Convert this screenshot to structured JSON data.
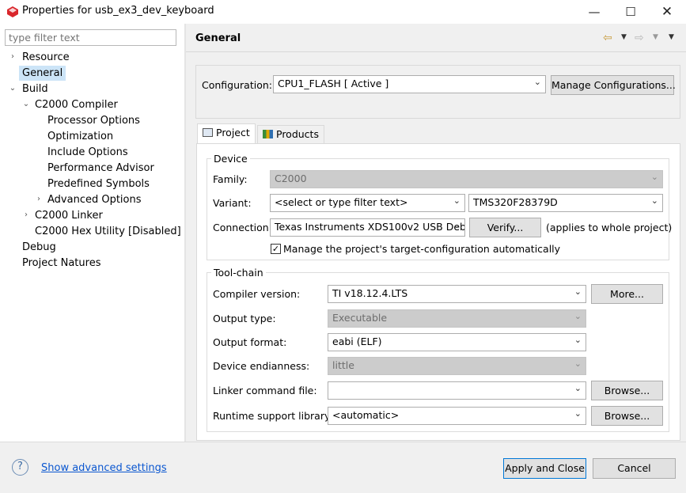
{
  "window": {
    "title": "Properties for usb_ex3_dev_keyboard"
  },
  "sidebar": {
    "filter_placeholder": "type filter text",
    "items": [
      {
        "label": "Resource"
      },
      {
        "label": "General"
      },
      {
        "label": "Build"
      },
      {
        "label": "C2000 Compiler"
      },
      {
        "label": "Processor Options"
      },
      {
        "label": "Optimization"
      },
      {
        "label": "Include Options"
      },
      {
        "label": "Performance Advisor"
      },
      {
        "label": "Predefined Symbols"
      },
      {
        "label": "Advanced Options"
      },
      {
        "label": "C2000 Linker"
      },
      {
        "label": "C2000 Hex Utility  [Disabled]"
      },
      {
        "label": "Debug"
      },
      {
        "label": "Project Natures"
      }
    ]
  },
  "page": {
    "title": "General"
  },
  "configuration": {
    "label": "Configuration:",
    "value": "CPU1_FLASH  [ Active ]",
    "manage_button": "Manage Configurations..."
  },
  "tabs": [
    {
      "label": "Project",
      "active": true
    },
    {
      "label": "Products",
      "active": false
    }
  ],
  "device": {
    "group_title": "Device",
    "family_label": "Family:",
    "family_value": "C2000",
    "variant_label": "Variant:",
    "variant_filter": "<select or type filter text>",
    "variant_value": "TMS320F28379D",
    "connection_label": "Connection:",
    "connection_value": "Texas Instruments XDS100v2 USB Deb",
    "verify_button": "Verify...",
    "connection_note": "(applies to whole project)",
    "manage_target_label": "Manage the project's target-configuration automatically",
    "manage_target_checked": true
  },
  "toolchain": {
    "group_title": "Tool-chain",
    "compiler_version_label": "Compiler version:",
    "compiler_version_value": "TI v18.12.4.LTS",
    "more_button": "More...",
    "output_type_label": "Output type:",
    "output_type_value": "Executable",
    "output_format_label": "Output format:",
    "output_format_value": "eabi (ELF)",
    "endianness_label": "Device endianness:",
    "endianness_value": "little",
    "linker_cmd_label": "Linker command file:",
    "linker_cmd_value": "",
    "browse_button_1": "Browse...",
    "runtime_lib_label": "Runtime support library:",
    "runtime_lib_value": "<automatic>",
    "browse_button_2": "Browse..."
  },
  "footer": {
    "advanced_link": "Show advanced settings",
    "apply_close_button": "Apply and Close",
    "cancel_button": "Cancel"
  }
}
